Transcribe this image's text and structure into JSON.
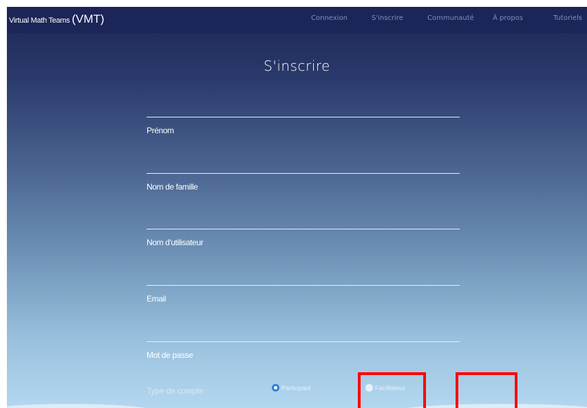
{
  "app": {
    "name": "Virtual Math Teams",
    "abbr": "(VMT)"
  },
  "nav": {
    "items": [
      {
        "label": "Connexion"
      },
      {
        "label": "S'inscrire"
      },
      {
        "label": "Communauté"
      },
      {
        "label": "À propos"
      },
      {
        "label": "Tutoriels"
      }
    ]
  },
  "form": {
    "title": "S'inscrire",
    "fields": [
      {
        "label": "Prénom",
        "value": ""
      },
      {
        "label": "Nom de famille",
        "value": ""
      },
      {
        "label": "Nom d'utilisateur",
        "value": ""
      },
      {
        "label": "Email",
        "value": ""
      },
      {
        "label": "Mot de passe",
        "value": ""
      }
    ],
    "account_type": {
      "label": "Type de compte",
      "options": [
        {
          "label": "Participant",
          "selected": true
        },
        {
          "label": "Facilitateur",
          "selected": false
        }
      ]
    }
  },
  "colors": {
    "navbar": "#1c2557",
    "nav_link": "#7f8fbc",
    "radio_accent": "#2f7fd6",
    "highlight": "#ff0000"
  }
}
